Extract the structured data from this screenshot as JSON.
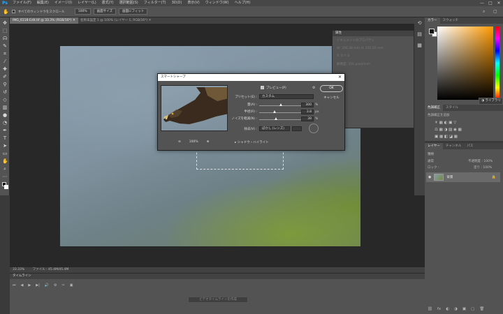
{
  "app": {
    "logo": "Ps",
    "menu": [
      "ファイル(F)",
      "編集(E)",
      "イメージ(I)",
      "レイヤー(L)",
      "書式(Y)",
      "選択範囲(S)",
      "フィルター(T)",
      "3D(D)",
      "表示(V)",
      "ウィンドウ(W)",
      "ヘルプ(H)"
    ],
    "window_controls": [
      "—",
      "□",
      "✕"
    ]
  },
  "options_bar": {
    "scroll_all_label": "すべてのウィンドウをスクロール",
    "zoom_button": "100%",
    "fit_screen_button": "画面サイズ",
    "fill_screen_button": "画面にフィット"
  },
  "document_tabs": [
    {
      "label": "IMG_6118-Edit.tif @ 33.3% (RGB/16*) ✕",
      "active": true
    },
    {
      "label": "名称未設定 1 @ 100% (レイヤー 1, RGB/16*) ✕",
      "active": false
    }
  ],
  "status": {
    "zoom": "33.33%",
    "file_info": "ファイル : 45.4M/45.4M"
  },
  "timeline": {
    "title": "タイムライン",
    "controls": [
      "⏮",
      "◀",
      "▶",
      "▶|",
      "🔊",
      "⚙",
      "✂",
      "▣"
    ],
    "create_button": "ビデオタイムラインを作成"
  },
  "properties_panel": {
    "title": "属性",
    "subtitle": "ドキュメントのプロパティ",
    "rows": [
      "W: 356.38 mm     H: 255.50 mm",
      "X: 0      Y: 0",
      "解像度: 350 pixel/inch"
    ]
  },
  "color_panel": {
    "tabs": [
      "カラー",
      "スウォッチ"
    ],
    "library_button": "ライブラリ",
    "fg_color": "#111111",
    "bg_color": "#ffffff"
  },
  "adjustments_panel": {
    "tabs": [
      "色調補正",
      "スタイル"
    ],
    "hint": "色調補正を追加",
    "row1": "☀ ▦ ◐ ▣ ▽",
    "row2": "⚖ ▦ ◑ ▨ ◉ ▦",
    "row3": "▣ ▦ ◧ ◪ ▦"
  },
  "layers_panel": {
    "tabs": [
      "レイヤー",
      "チャンネル",
      "パス"
    ],
    "kind_label": "種類",
    "blend_mode": "通常",
    "opacity_label": "不透明度 : 100%",
    "lock_label": "ロック :",
    "fill_label": "塗り : 100%",
    "layer_name": "背景",
    "footer": [
      "⛓",
      "fx",
      "◐",
      "◑",
      "▣",
      "▢",
      "🗑"
    ]
  },
  "dialog": {
    "title": "スマートシャープ",
    "preview_label": "プレビュー(P)",
    "preset_label": "プリセット(E) :",
    "preset_value": "カスタム",
    "amount_label": "量(A) :",
    "amount_value": "300",
    "amount_unit": "%",
    "amount_fraction": 0.5,
    "radius_label": "半径(R) :",
    "radius_value": "3.8",
    "radius_unit": "px",
    "radius_fraction": 0.35,
    "noise_label": "ノイズを軽減(N) :",
    "noise_value": "39",
    "noise_unit": "%",
    "noise_fraction": 0.39,
    "remove_label": "除去(V) :",
    "remove_value": "ぼかし (レンズ)",
    "zoom_out": "⊖",
    "zoom_level": "100%",
    "zoom_in": "⊕",
    "shadow_highlight_label": "シャドウ・ハイライト",
    "ok_label": "OK",
    "cancel_label": "キャンセル"
  }
}
